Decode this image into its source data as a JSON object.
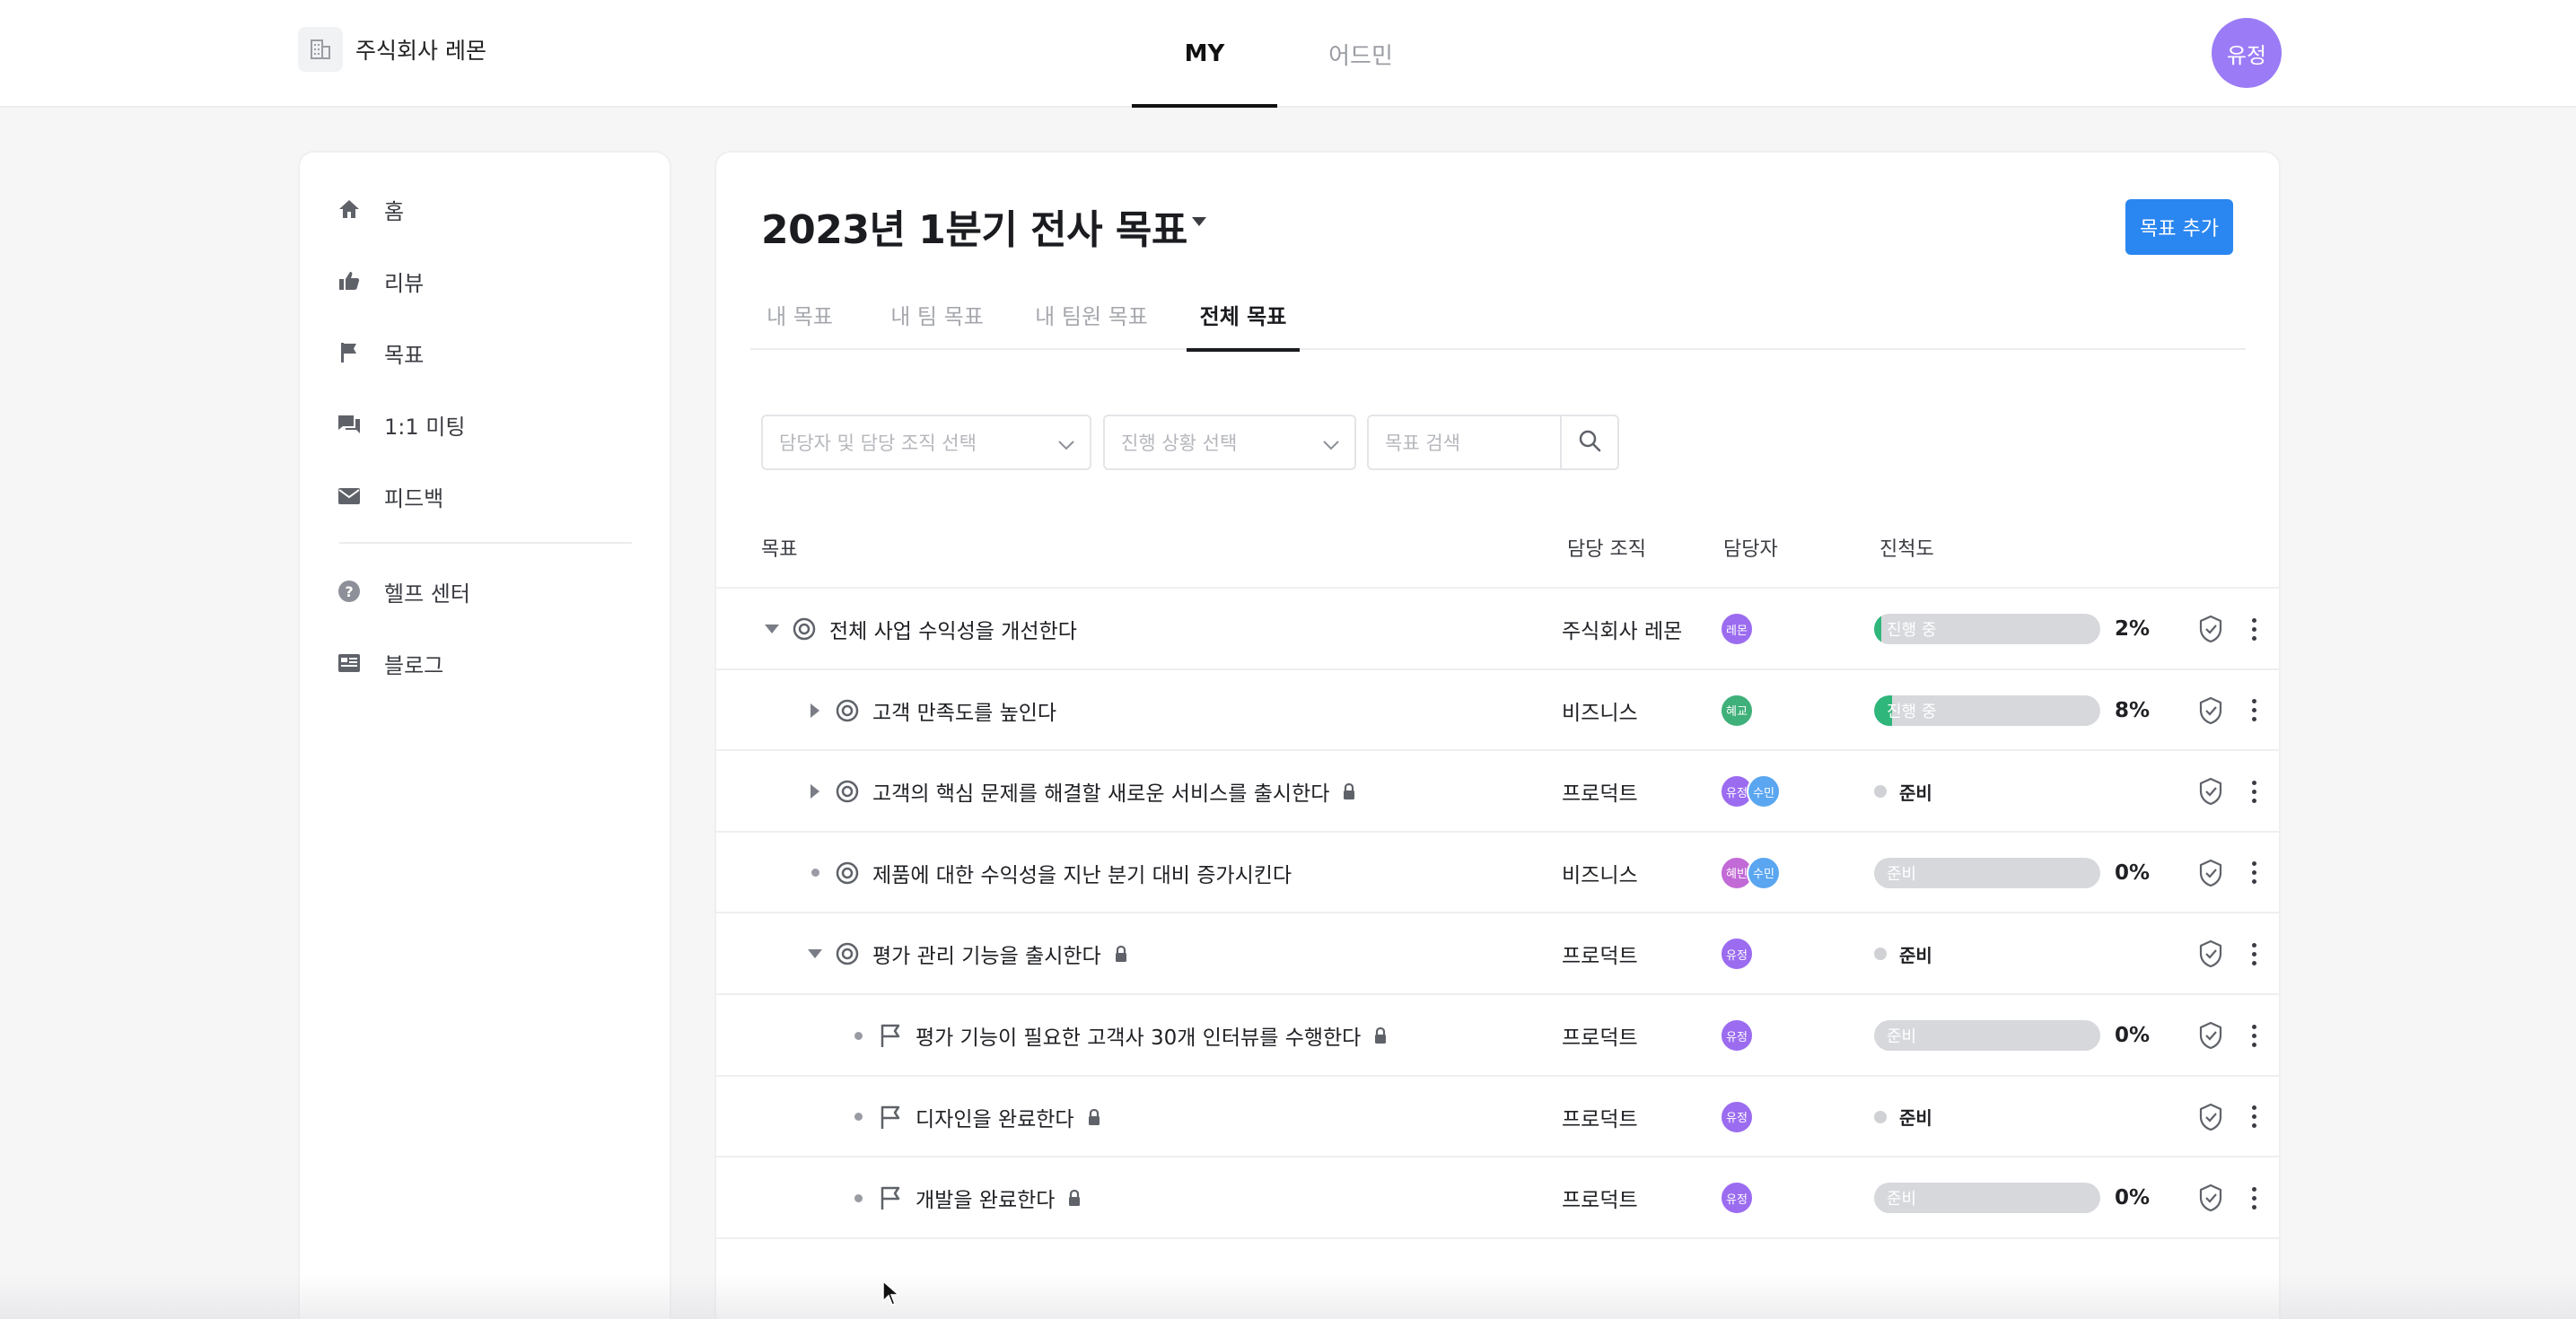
{
  "topbar": {
    "company_name": "주식회사 레몬",
    "tabs": [
      {
        "label": "MY",
        "active": true
      },
      {
        "label": "어드민",
        "active": false
      }
    ],
    "user_initials": "유정"
  },
  "sidebar": {
    "items": [
      {
        "label": "홈",
        "icon": "home-icon"
      },
      {
        "label": "리뷰",
        "icon": "thumbs-up-icon"
      },
      {
        "label": "목표",
        "icon": "flag-icon"
      },
      {
        "label": "1:1 미팅",
        "icon": "chat-icon"
      },
      {
        "label": "피드백",
        "icon": "mail-icon"
      },
      {
        "label": "헬프 센터",
        "icon": "help-icon"
      },
      {
        "label": "블로그",
        "icon": "blog-icon"
      }
    ]
  },
  "main": {
    "title": "2023년 1분기 전사 목표",
    "add_button": "목표 추가",
    "tabs": [
      {
        "label": "내 목표",
        "active": false
      },
      {
        "label": "내 팀 목표",
        "active": false
      },
      {
        "label": "내 팀원 목표",
        "active": false
      },
      {
        "label": "전체 목표",
        "active": true
      }
    ],
    "filters": {
      "owner_placeholder": "담당자 및 담당 조직 선택",
      "status_placeholder": "진행 상황 선택",
      "search_placeholder": "목표 검색"
    },
    "table": {
      "headers": {
        "goal": "목표",
        "org": "담당 조직",
        "owner": "담당자",
        "progress": "진척도"
      },
      "rows": [
        {
          "goal": "전체 사업 수익성을 개선한다",
          "org": "주식회사 레몬",
          "owners": [
            {
              "initials": "레몬",
              "color": "#9b6cf0"
            }
          ],
          "progress_label": "진행 중",
          "progress": 2,
          "pct": "2%",
          "status": "",
          "locked": false,
          "expand": "down",
          "kind": "target"
        },
        {
          "goal": "고객 만족도를 높인다",
          "org": "비즈니스",
          "owners": [
            {
              "initials": "혜교",
              "color": "#3fb07a"
            }
          ],
          "progress_label": "진행 중",
          "progress": 8,
          "pct": "8%",
          "status": "",
          "locked": false,
          "expand": "right",
          "kind": "target"
        },
        {
          "goal": "고객의 핵심 문제를 해결할 새로운 서비스를 출시한다",
          "org": "프로덕트",
          "owners": [
            {
              "initials": "유정",
              "color": "#9b6cf0"
            },
            {
              "initials": "수민",
              "color": "#5aa6f0"
            }
          ],
          "progress_label": "",
          "progress": null,
          "pct": "",
          "status": "준비",
          "locked": true,
          "expand": "right",
          "kind": "target"
        },
        {
          "goal": "제품에 대한 수익성을 지난 분기 대비 증가시킨다",
          "org": "비즈니스",
          "owners": [
            {
              "initials": "혜빈",
              "color": "#c26ad6"
            },
            {
              "initials": "수민",
              "color": "#5aa6f0"
            }
          ],
          "progress_label": "준비",
          "progress": 0,
          "pct": "0%",
          "status": "",
          "locked": false,
          "expand": "dot",
          "kind": "target"
        },
        {
          "goal": "평가 관리 기능을 출시한다",
          "org": "프로덕트",
          "owners": [
            {
              "initials": "유정",
              "color": "#9b6cf0"
            }
          ],
          "progress_label": "",
          "progress": null,
          "pct": "",
          "status": "준비",
          "locked": true,
          "expand": "down",
          "kind": "target"
        },
        {
          "goal": "평가 기능이 필요한 고객사 30개 인터뷰를 수행한다",
          "org": "프로덕트",
          "owners": [
            {
              "initials": "유정",
              "color": "#9b6cf0"
            }
          ],
          "progress_label": "준비",
          "progress": 0,
          "pct": "0%",
          "status": "",
          "locked": true,
          "expand": "dot",
          "kind": "flag"
        },
        {
          "goal": "디자인을 완료한다",
          "org": "프로덕트",
          "owners": [
            {
              "initials": "유정",
              "color": "#9b6cf0"
            }
          ],
          "progress_label": "",
          "progress": null,
          "pct": "",
          "status": "준비",
          "locked": true,
          "expand": "dot",
          "kind": "flag"
        },
        {
          "goal": "개발을 완료한다",
          "org": "프로덕트",
          "owners": [
            {
              "initials": "유정",
              "color": "#9b6cf0"
            }
          ],
          "progress_label": "준비",
          "progress": 0,
          "pct": "0%",
          "status": "",
          "locked": true,
          "expand": "dot",
          "kind": "flag"
        }
      ]
    }
  },
  "colors": {
    "accent": "#2a86f0",
    "progress_green": "#2fb67a",
    "avatar_purple": "#9b7cf6"
  }
}
